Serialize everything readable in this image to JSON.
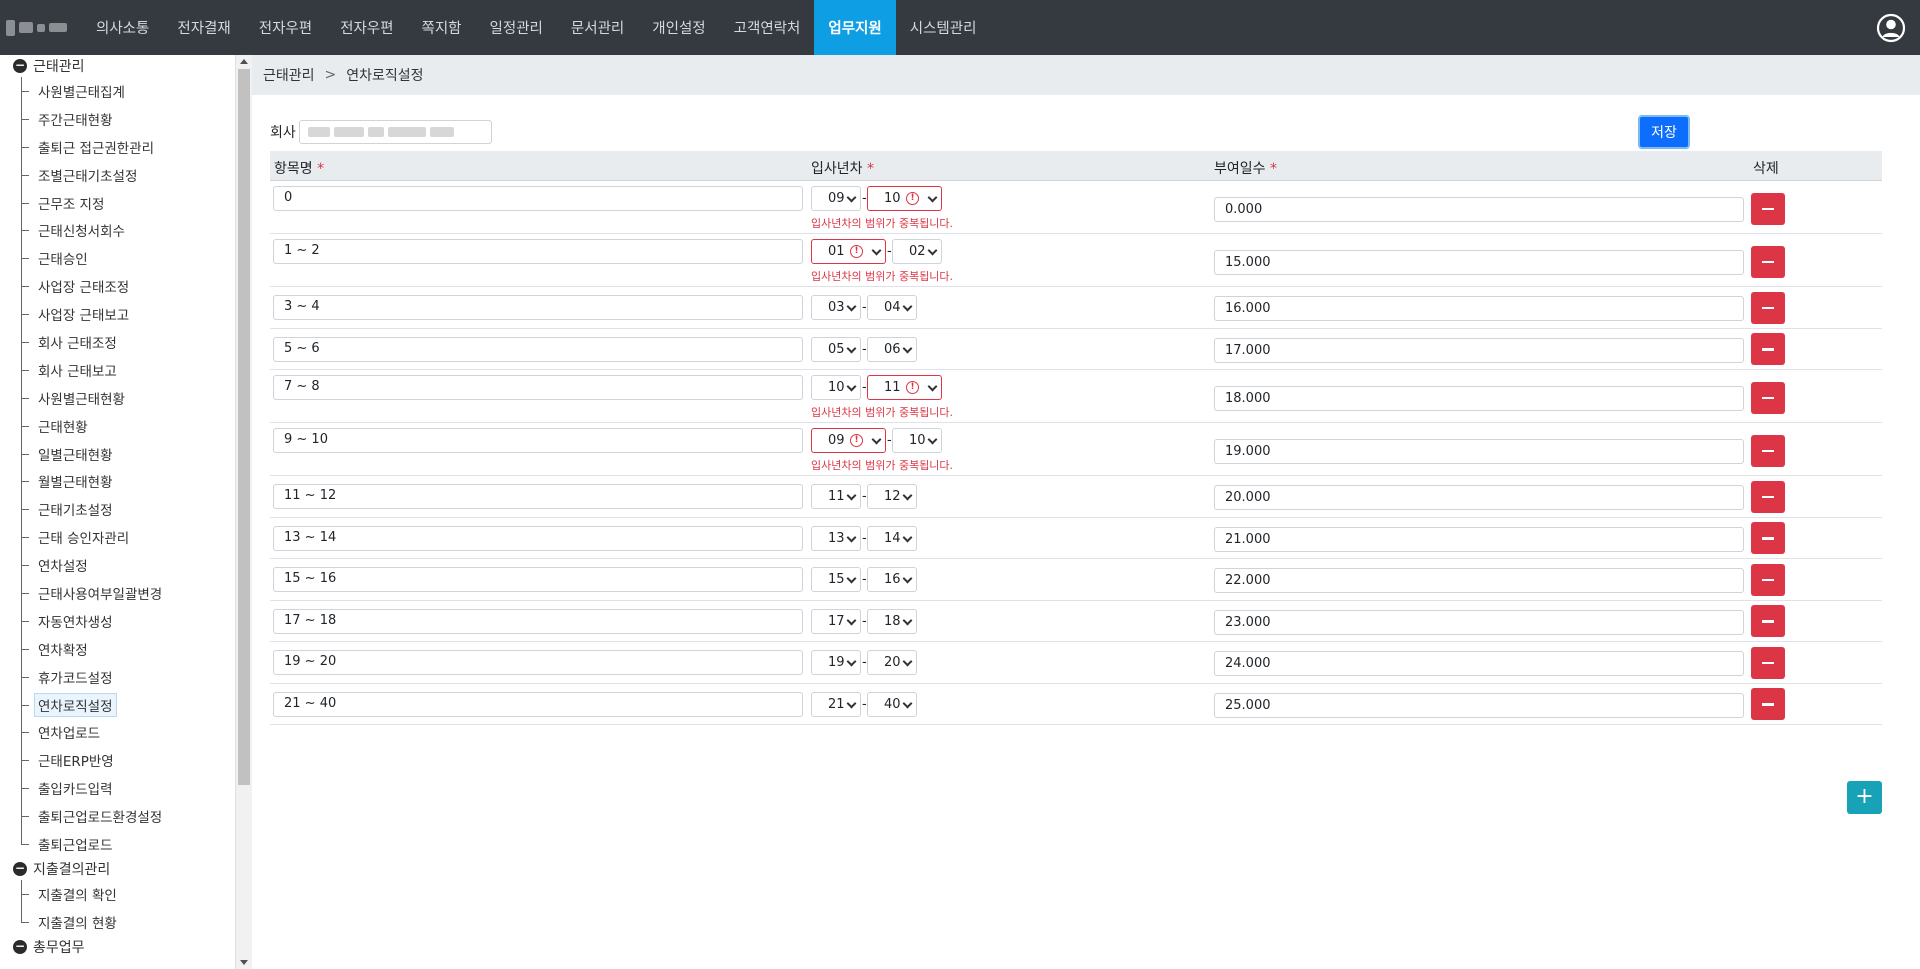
{
  "nav": {
    "items": [
      "의사소통",
      "전자결재",
      "전자우편",
      "전자우편",
      "쪽지함",
      "일정관리",
      "문서관리",
      "개인설정",
      "고객연락처",
      "업무지원",
      "시스템관리"
    ],
    "active_index": 9
  },
  "sidebar": {
    "group1": "근태관리",
    "items": [
      "사원별근태집계",
      "주간근태현황",
      "출퇴근 접근권한관리",
      "조별근태기초설정",
      "근무조 지정",
      "근태신청서회수",
      "근태승인",
      "사업장 근태조정",
      "사업장 근태보고",
      "회사 근태조정",
      "회사 근태보고",
      "사원별근태현황",
      "근태현황",
      "일별근태현황",
      "월별근태현황",
      "근태기초설정",
      "근태 승인자관리",
      "연차설정",
      "근태사용여부일괄변경",
      "자동연차생성",
      "연차확정",
      "휴가코드설정",
      "연차로직설정",
      "연차업로드",
      "근태ERP반영",
      "출입카드입력",
      "출퇴근업로드환경설정",
      "출퇴근업로드"
    ],
    "selected": "연차로직설정",
    "group2": "지출결의관리",
    "group2_items": [
      "지출결의 확인",
      "지출결의 현황"
    ],
    "group3": "총무업무"
  },
  "breadcrumb": {
    "parent": "근태관리",
    "separator": ">",
    "current": "연차로직설정"
  },
  "form": {
    "company_label": "회사",
    "save_label": "저장"
  },
  "table": {
    "headers": {
      "name": "항목명",
      "years": "입사년차",
      "days": "부여일수",
      "delete": "삭제",
      "required_mark": "*"
    },
    "error_message": "입사년차의 범위가 중복됩니다.",
    "range_dash": "-",
    "rows": [
      {
        "name": "0",
        "from": "09",
        "to": "10",
        "days": "0.000",
        "from_err": false,
        "to_err": true,
        "msg": true
      },
      {
        "name": "1 ~ 2",
        "from": "01",
        "to": "02",
        "days": "15.000",
        "from_err": true,
        "to_err": false,
        "msg": true
      },
      {
        "name": "3 ~ 4",
        "from": "03",
        "to": "04",
        "days": "16.000",
        "from_err": false,
        "to_err": false,
        "msg": false
      },
      {
        "name": "5 ~ 6",
        "from": "05",
        "to": "06",
        "days": "17.000",
        "from_err": false,
        "to_err": false,
        "msg": false
      },
      {
        "name": "7 ~ 8",
        "from": "10",
        "to": "11",
        "days": "18.000",
        "from_err": false,
        "to_err": true,
        "msg": true
      },
      {
        "name": "9 ~ 10",
        "from": "09",
        "to": "10",
        "days": "19.000",
        "from_err": true,
        "to_err": false,
        "msg": true
      },
      {
        "name": "11 ~ 12",
        "from": "11",
        "to": "12",
        "days": "20.000",
        "from_err": false,
        "to_err": false,
        "msg": false
      },
      {
        "name": "13 ~ 14",
        "from": "13",
        "to": "14",
        "days": "21.000",
        "from_err": false,
        "to_err": false,
        "msg": false
      },
      {
        "name": "15 ~ 16",
        "from": "15",
        "to": "16",
        "days": "22.000",
        "from_err": false,
        "to_err": false,
        "msg": false
      },
      {
        "name": "17 ~ 18",
        "from": "17",
        "to": "18",
        "days": "23.000",
        "from_err": false,
        "to_err": false,
        "msg": false
      },
      {
        "name": "19 ~ 20",
        "from": "19",
        "to": "20",
        "days": "24.000",
        "from_err": false,
        "to_err": false,
        "msg": false
      },
      {
        "name": "21 ~ 40",
        "from": "21",
        "to": "40",
        "days": "25.000",
        "from_err": false,
        "to_err": false,
        "msg": false
      }
    ]
  },
  "icons": {
    "user": "user-circle-icon",
    "delete": "minus-icon",
    "add": "plus-icon",
    "warning": "exclamation-circle-icon"
  },
  "colors": {
    "topbar": "#343a40",
    "active_nav": "#0d9ee3",
    "primary": "#0d6efd",
    "danger": "#dc3545",
    "info": "#17a2b8"
  }
}
